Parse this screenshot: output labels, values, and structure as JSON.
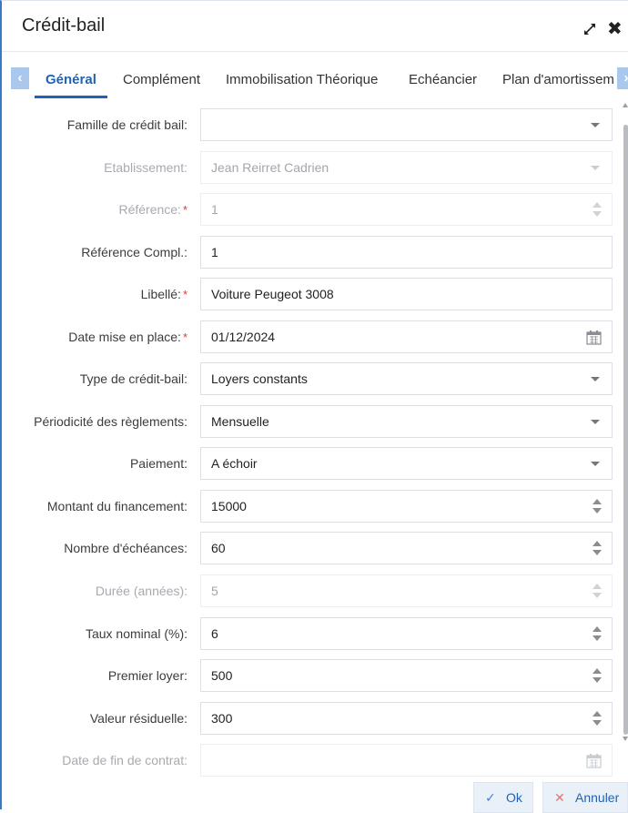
{
  "dialog": {
    "title": "Crédit-bail"
  },
  "tabs": [
    {
      "label": "Général",
      "active": true
    },
    {
      "label": "Complément",
      "active": false
    },
    {
      "label": "Immobilisation Théorique",
      "active": false
    },
    {
      "label": "Echéancier",
      "active": false
    },
    {
      "label": "Plan d'amortissem",
      "active": false
    }
  ],
  "form": {
    "famille": {
      "label": "Famille de crédit bail:",
      "value": ""
    },
    "etablissement": {
      "label": "Etablissement:",
      "value": "Jean Reirret Cadrien"
    },
    "reference": {
      "label": "Référence:",
      "value": "1",
      "required": "*"
    },
    "reference_compl": {
      "label": "Référence Compl.:",
      "value": "1"
    },
    "libelle": {
      "label": "Libellé:",
      "value": "Voiture Peugeot 3008",
      "required": "*"
    },
    "date_mise_en_place": {
      "label": "Date mise en place:",
      "value": "01/12/2024",
      "required": "*"
    },
    "type_credit_bail": {
      "label": "Type de crédit-bail:",
      "value": "Loyers constants"
    },
    "periodicite": {
      "label": "Périodicité des règlements:",
      "value": "Mensuelle"
    },
    "paiement": {
      "label": "Paiement:",
      "value": "A échoir"
    },
    "montant": {
      "label": "Montant du financement:",
      "value": "15000"
    },
    "nombre_echeances": {
      "label": "Nombre d'échéances:",
      "value": "60"
    },
    "duree": {
      "label": "Durée (années):",
      "value": "5"
    },
    "taux": {
      "label": "Taux nominal (%):",
      "value": "6"
    },
    "premier_loyer": {
      "label": "Premier loyer:",
      "value": "500"
    },
    "valeur_residuelle": {
      "label": "Valeur résiduelle:",
      "value": "300"
    },
    "date_fin": {
      "label": "Date de fin de contrat:",
      "value": ""
    }
  },
  "footer": {
    "ok_label": "Ok",
    "cancel_label": "Annuler"
  },
  "colors": {
    "accent": "#1e63b8",
    "required": "#e53935",
    "disabled_text": "#a7aab0"
  }
}
